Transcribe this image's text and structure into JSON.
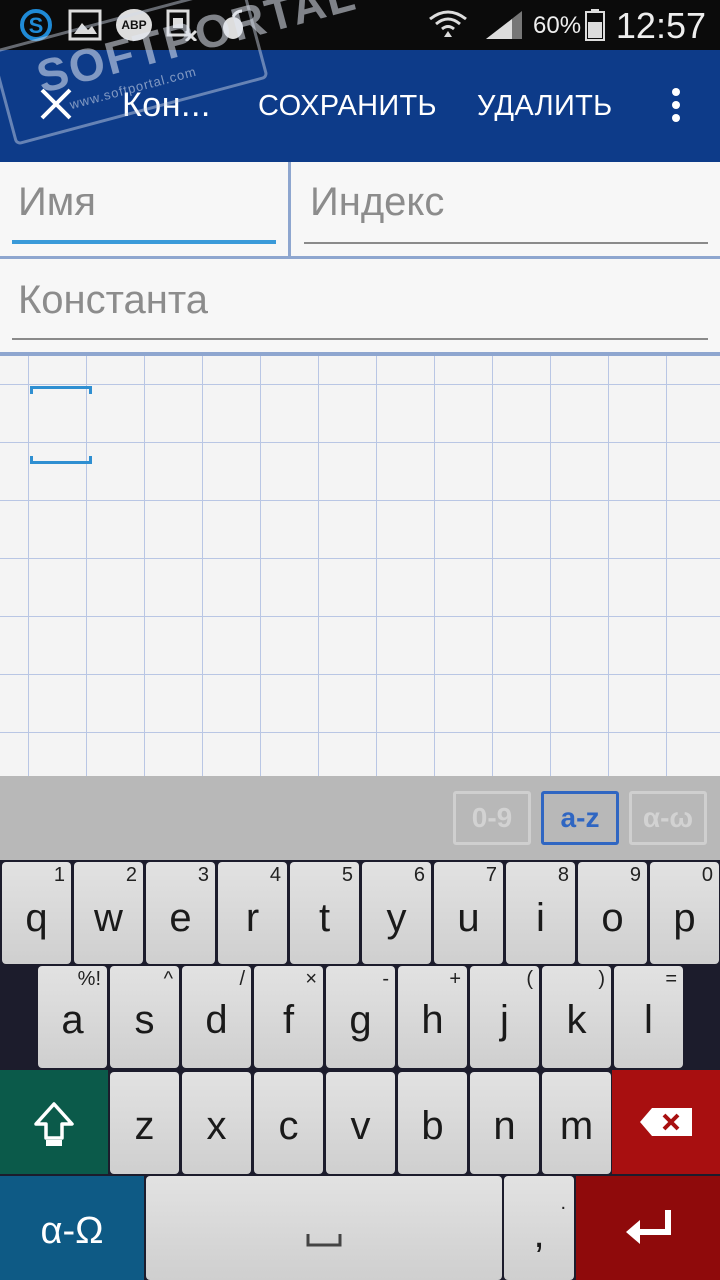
{
  "status_bar": {
    "time": "12:57",
    "battery_percent": "60%",
    "icons": [
      "skype-icon",
      "gallery-icon",
      "adblock-icon",
      "no-sim-icon",
      "downloader-icon",
      "wifi-icon",
      "signal-icon",
      "battery-icon"
    ],
    "adblock_label": "ABP"
  },
  "app_bar": {
    "title": "Кон...",
    "save_label": "СОХРАНИТЬ",
    "delete_label": "УДАЛИТЬ",
    "color": "#0d3b89"
  },
  "watermark": {
    "main": "SOFTPORTAL",
    "sub": "www.softportal.com"
  },
  "form": {
    "name_placeholder": "Имя",
    "index_placeholder": "Индекс",
    "constant_placeholder": "Константа",
    "focus_color": "#3a9ad9"
  },
  "mode_bar": {
    "digits_label": "0-9",
    "latin_label": "a-z",
    "greek_label": "α-ω",
    "active": "a-z"
  },
  "keyboard": {
    "row1": [
      {
        "key": "q",
        "sec": "1"
      },
      {
        "key": "w",
        "sec": "2"
      },
      {
        "key": "e",
        "sec": "3"
      },
      {
        "key": "r",
        "sec": "4"
      },
      {
        "key": "t",
        "sec": "5"
      },
      {
        "key": "y",
        "sec": "6"
      },
      {
        "key": "u",
        "sec": "7"
      },
      {
        "key": "i",
        "sec": "8"
      },
      {
        "key": "o",
        "sec": "9"
      },
      {
        "key": "p",
        "sec": "0"
      }
    ],
    "row2": [
      {
        "key": "a",
        "sec": "%!"
      },
      {
        "key": "s",
        "sec": "^"
      },
      {
        "key": "d",
        "sec": "/"
      },
      {
        "key": "f",
        "sec": "×"
      },
      {
        "key": "g",
        "sec": "-"
      },
      {
        "key": "h",
        "sec": "+"
      },
      {
        "key": "j",
        "sec": "("
      },
      {
        "key": "k",
        "sec": ")"
      },
      {
        "key": "l",
        "sec": "="
      }
    ],
    "row3": [
      {
        "key": "z"
      },
      {
        "key": "x"
      },
      {
        "key": "c"
      },
      {
        "key": "v"
      },
      {
        "key": "b"
      },
      {
        "key": "n"
      },
      {
        "key": "m"
      }
    ],
    "greek_switch_label": "α-Ω",
    "comma_label": ",",
    "comma_sec": "."
  }
}
